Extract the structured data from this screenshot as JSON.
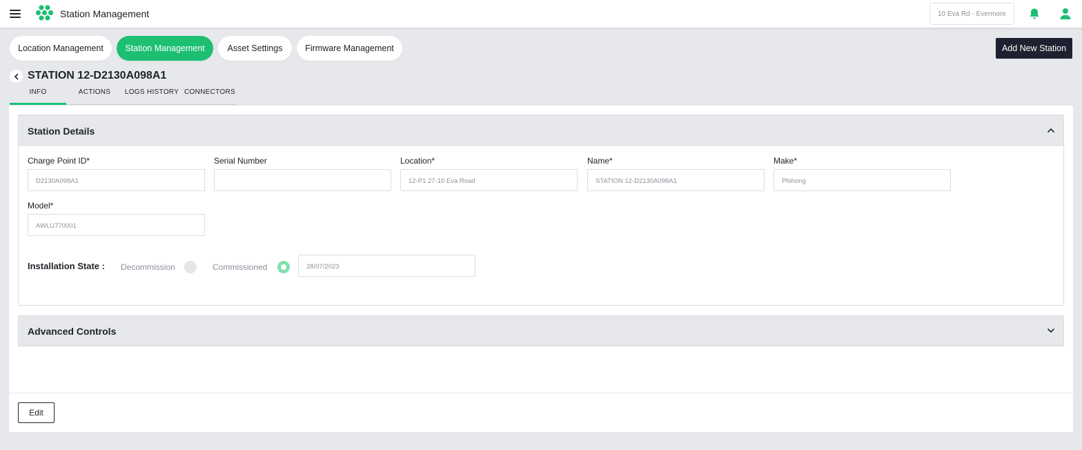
{
  "header": {
    "app_title": "Station Management",
    "location_selector": "10 Eva Rd - Evermore",
    "icons": [
      "menu-icon",
      "logo-icon",
      "bell-icon",
      "user-icon"
    ],
    "accent_color": "#1dbf73"
  },
  "nav_pills": [
    {
      "label": "Location Management",
      "active": false
    },
    {
      "label": "Station Management",
      "active": true
    },
    {
      "label": "Asset Settings",
      "active": false
    },
    {
      "label": "Firmware Management",
      "active": false
    }
  ],
  "add_station_label": "Add New Station",
  "station": {
    "title": "STATION 12-D2130A098A1"
  },
  "tabs": [
    {
      "label": "INFO",
      "active": true
    },
    {
      "label": "ACTIONS",
      "active": false
    },
    {
      "label": "LOGS HISTORY",
      "active": false
    },
    {
      "label": "CONNECTORS",
      "active": false
    }
  ],
  "station_details": {
    "title": "Station Details",
    "fields": [
      {
        "label": "Charge Point ID*",
        "value": "D2130A098A1"
      },
      {
        "label": "Serial Number",
        "value": ""
      },
      {
        "label": "Location*",
        "value": "12-P1 27-10 Eva Road"
      },
      {
        "label": "Name*",
        "value": "STATION 12-D2130A098A1"
      },
      {
        "label": "Make*",
        "value": "Phihong"
      },
      {
        "label": "Model*",
        "value": "AWLU770001"
      }
    ],
    "installation_state": {
      "label": "Installation State :",
      "options": [
        {
          "label": "Decommission",
          "selected": false
        },
        {
          "label": "Commissioned",
          "selected": true
        }
      ],
      "date": "28/07/2023"
    }
  },
  "advanced_controls": {
    "title": "Advanced Controls"
  },
  "edit_label": "Edit"
}
